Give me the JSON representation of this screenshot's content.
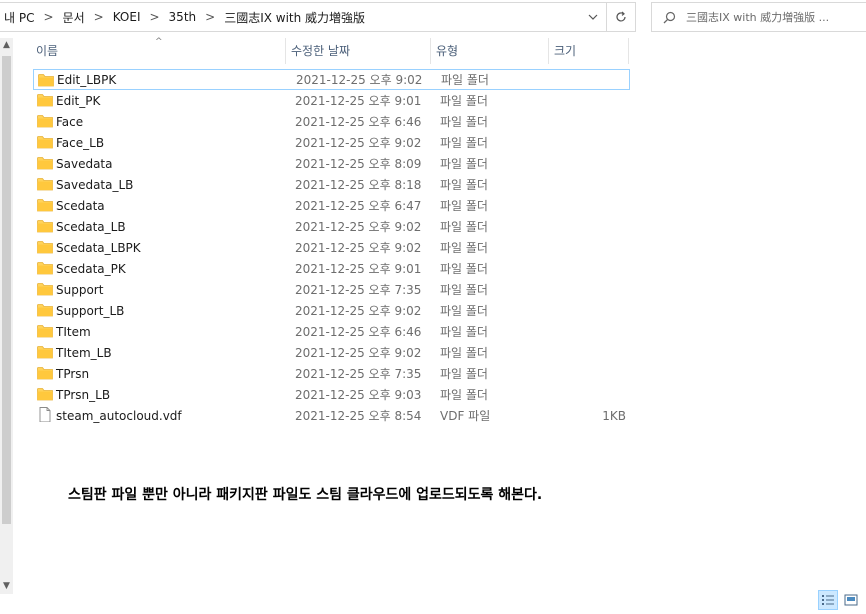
{
  "breadcrumb": [
    "내 PC",
    "문서",
    "KOEI",
    "35th",
    "三國志IX with 威力増強版"
  ],
  "search": {
    "placeholder": "三國志IX with 威力増強版 ..."
  },
  "columns": {
    "name": "이름",
    "modified": "수정한 날짜",
    "type": "유형",
    "size": "크기"
  },
  "files": [
    {
      "name": "Edit_LBPK",
      "modified": "2021-12-25 오후 9:02",
      "type": "파일 폴더",
      "size": "",
      "kind": "folder"
    },
    {
      "name": "Edit_PK",
      "modified": "2021-12-25 오후 9:01",
      "type": "파일 폴더",
      "size": "",
      "kind": "folder"
    },
    {
      "name": "Face",
      "modified": "2021-12-25 오후 6:46",
      "type": "파일 폴더",
      "size": "",
      "kind": "folder"
    },
    {
      "name": "Face_LB",
      "modified": "2021-12-25 오후 9:02",
      "type": "파일 폴더",
      "size": "",
      "kind": "folder"
    },
    {
      "name": "Savedata",
      "modified": "2021-12-25 오후 8:09",
      "type": "파일 폴더",
      "size": "",
      "kind": "folder"
    },
    {
      "name": "Savedata_LB",
      "modified": "2021-12-25 오후 8:18",
      "type": "파일 폴더",
      "size": "",
      "kind": "folder"
    },
    {
      "name": "Scedata",
      "modified": "2021-12-25 오후 6:47",
      "type": "파일 폴더",
      "size": "",
      "kind": "folder"
    },
    {
      "name": "Scedata_LB",
      "modified": "2021-12-25 오후 9:02",
      "type": "파일 폴더",
      "size": "",
      "kind": "folder"
    },
    {
      "name": "Scedata_LBPK",
      "modified": "2021-12-25 오후 9:02",
      "type": "파일 폴더",
      "size": "",
      "kind": "folder"
    },
    {
      "name": "Scedata_PK",
      "modified": "2021-12-25 오후 9:01",
      "type": "파일 폴더",
      "size": "",
      "kind": "folder"
    },
    {
      "name": "Support",
      "modified": "2021-12-25 오후 7:35",
      "type": "파일 폴더",
      "size": "",
      "kind": "folder"
    },
    {
      "name": "Support_LB",
      "modified": "2021-12-25 오후 9:02",
      "type": "파일 폴더",
      "size": "",
      "kind": "folder"
    },
    {
      "name": "TItem",
      "modified": "2021-12-25 오후 6:46",
      "type": "파일 폴더",
      "size": "",
      "kind": "folder"
    },
    {
      "name": "TItem_LB",
      "modified": "2021-12-25 오후 9:02",
      "type": "파일 폴더",
      "size": "",
      "kind": "folder"
    },
    {
      "name": "TPrsn",
      "modified": "2021-12-25 오후 7:35",
      "type": "파일 폴더",
      "size": "",
      "kind": "folder"
    },
    {
      "name": "TPrsn_LB",
      "modified": "2021-12-25 오후 9:03",
      "type": "파일 폴더",
      "size": "",
      "kind": "folder"
    },
    {
      "name": "steam_autocloud.vdf",
      "modified": "2021-12-25 오후 8:54",
      "type": "VDF 파일",
      "size": "1KB",
      "kind": "file"
    }
  ],
  "note": "스팀판 파일 뿐만 아니라 패키지판 파일도 스팀 클라우드에 업로드되도록 해본다.",
  "icons": {
    "folder": "folder-icon",
    "file": "file-icon",
    "search": "search-icon",
    "refresh": "refresh-icon",
    "dropdown": "chevron-down-icon",
    "details_view": "details-view-icon",
    "tiles_view": "large-icons-view-icon"
  },
  "colors": {
    "folder": "#ffd35b",
    "folder_tab": "#e8b23a",
    "focus_border": "#99d1ff",
    "header_text": "#4c607a"
  }
}
